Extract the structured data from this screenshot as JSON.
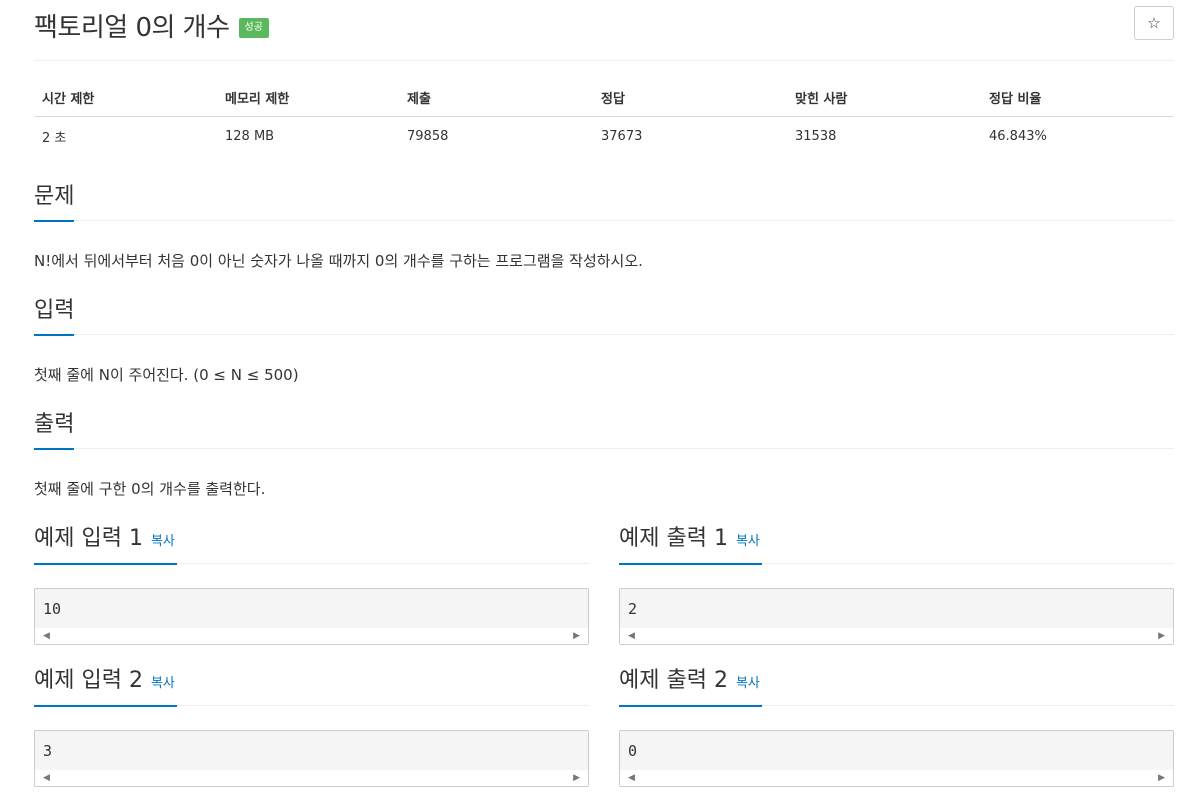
{
  "problem": {
    "title": "팩토리얼 0의 개수",
    "status_badge": "성공",
    "star_icon": "☆"
  },
  "info": {
    "headers": [
      "시간 제한",
      "메모리 제한",
      "제출",
      "정답",
      "맞힌 사람",
      "정답 비율"
    ],
    "values": [
      "2 초",
      "128 MB",
      "79858",
      "37673",
      "31538",
      "46.843%"
    ]
  },
  "sections": {
    "problem_heading": "문제",
    "problem_text": "N!에서 뒤에서부터 처음 0이 아닌 숫자가 나올 때까지 0의 개수를 구하는 프로그램을 작성하시오.",
    "input_heading": "입력",
    "input_text": "첫째 줄에 N이 주어진다. (0 ≤ N ≤ 500)",
    "output_heading": "출력",
    "output_text": "첫째 줄에 구한 0의 개수를 출력한다."
  },
  "samples": {
    "copy_label": "복사",
    "input1_heading": "예제 입력 1",
    "input1_value": "10",
    "output1_heading": "예제 출력 1",
    "output1_value": "2",
    "input2_heading": "예제 입력 2",
    "input2_value": "3",
    "output2_heading": "예제 출력 2",
    "output2_value": "0",
    "scroll_left_icon": "◀",
    "scroll_right_icon": "▶"
  },
  "colors": {
    "accent": "#0076c0",
    "badge_success": "#5cb85c",
    "sample_bg": "#f5f5f5"
  }
}
